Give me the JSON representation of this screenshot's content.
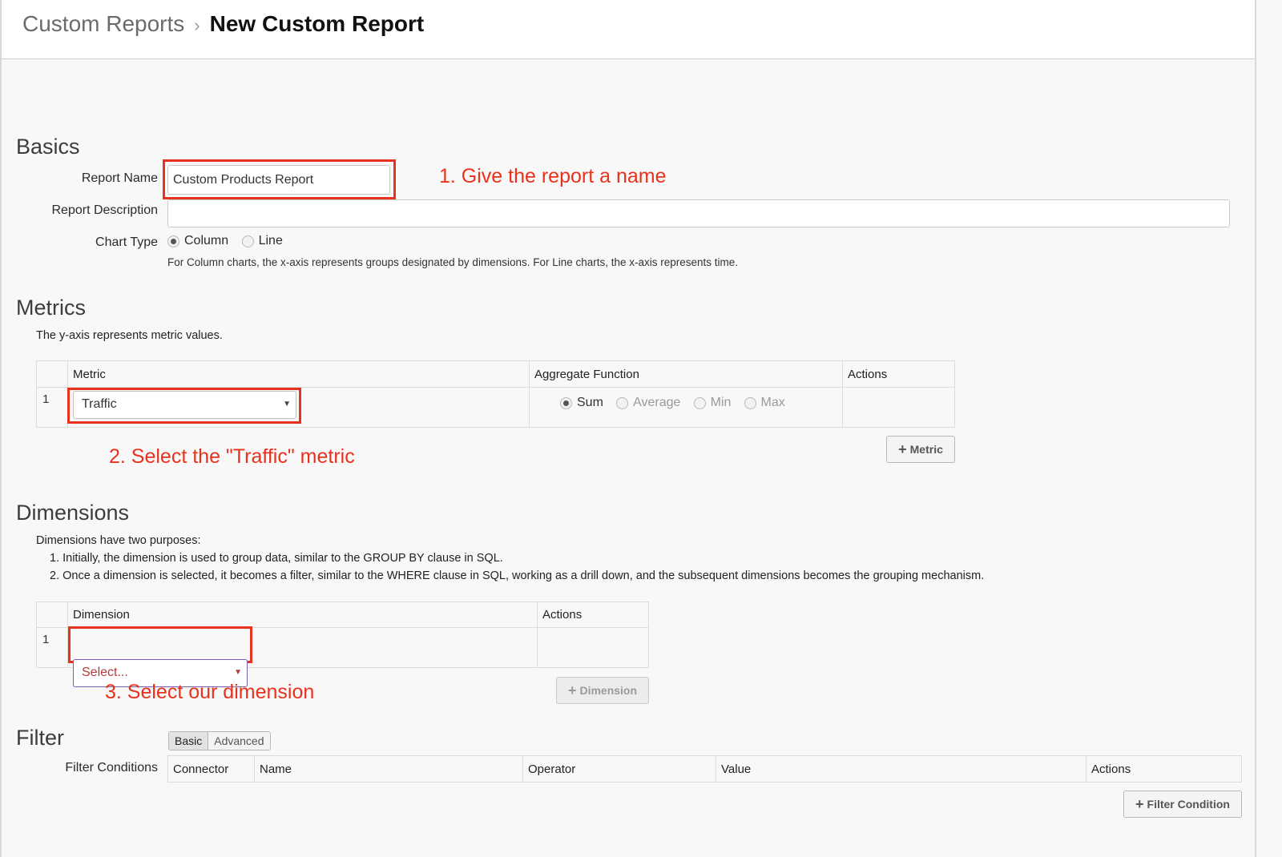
{
  "breadcrumb": {
    "parent": "Custom Reports",
    "separator": "›",
    "current": "New Custom Report"
  },
  "basics": {
    "title": "Basics",
    "report_name_label": "Report Name",
    "report_name_value": "Custom Products Report",
    "report_description_label": "Report Description",
    "report_description_value": "",
    "chart_type_label": "Chart Type",
    "chart_type_options": [
      "Column",
      "Line"
    ],
    "chart_type_selected": "Column",
    "chart_type_help": "For Column charts, the x-axis represents groups designated by dimensions. For Line charts, the x-axis represents time."
  },
  "metrics": {
    "title": "Metrics",
    "description": "The y-axis represents metric values.",
    "columns": [
      "",
      "Metric",
      "Aggregate Function",
      "Actions"
    ],
    "rows": [
      {
        "index": "1",
        "metric": "Traffic"
      }
    ],
    "aggregate_options": [
      "Sum",
      "Average",
      "Min",
      "Max"
    ],
    "aggregate_selected": "Sum",
    "add_button": "Metric"
  },
  "dimensions": {
    "title": "Dimensions",
    "intro": "Dimensions have two purposes:",
    "purposes": [
      "1. Initially, the dimension is used to group data, similar to the GROUP BY clause in SQL.",
      "2. Once a dimension is selected, it becomes a filter, similar to the WHERE clause in SQL, working as a drill down, and the subsequent dimensions becomes the grouping mechanism."
    ],
    "columns": [
      "",
      "Dimension",
      "Actions"
    ],
    "rows": [
      {
        "index": "1",
        "placeholder": "Select..."
      }
    ],
    "add_button": "Dimension"
  },
  "filter": {
    "title": "Filter",
    "modes": [
      "Basic",
      "Advanced"
    ],
    "active_mode": "Basic",
    "conditions_label": "Filter Conditions",
    "columns": [
      "Connector",
      "Name",
      "Operator",
      "Value",
      "Actions"
    ],
    "add_button": "Filter Condition"
  },
  "annotations": {
    "step1": "1. Give the report a name",
    "step2": "2. Select the \"Traffic\" metric",
    "step3": "3. Select our dimension"
  },
  "colors": {
    "annotation": "#e8321d",
    "dimension_placeholder": "#b23a3a"
  }
}
